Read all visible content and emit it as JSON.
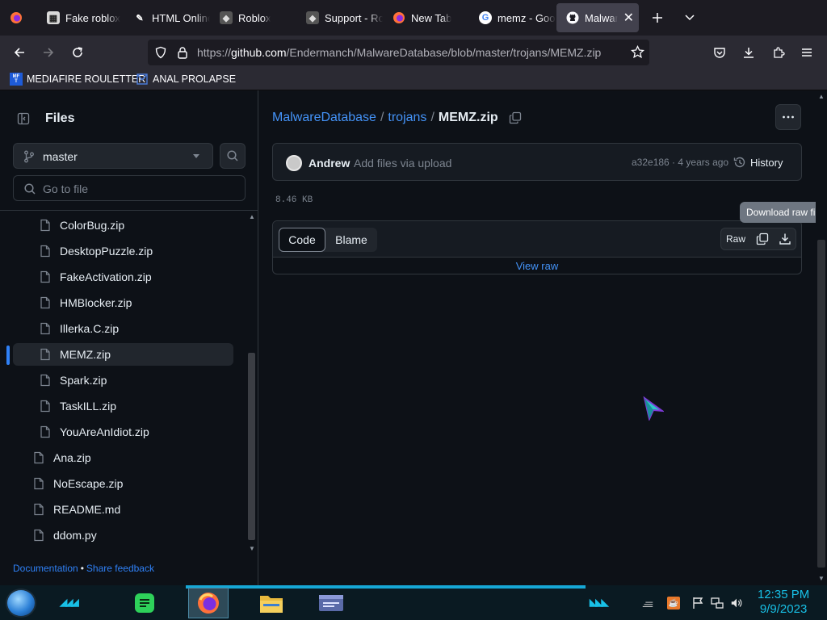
{
  "browser": {
    "tabs": [
      {
        "title": "Fake roblox",
        "icon": "roblox-logo"
      },
      {
        "title": "HTML Online",
        "icon": "pencil-icon"
      },
      {
        "title": "Roblox",
        "icon": "roblox-logo"
      },
      {
        "title": "Support - Roblox",
        "icon": "roblox-logo"
      },
      {
        "title": "New Tab",
        "icon": "firefox-logo"
      },
      {
        "title": "memz - Google",
        "icon": "google-logo"
      },
      {
        "title": "MalwareDatabase",
        "icon": "github-logo"
      }
    ],
    "url": {
      "prefix": "https://",
      "domain": "github.com",
      "path": "/Endermanch/MalwareDatabase/blob/master/trojans/MEMZ.zip"
    },
    "bookmarks": [
      {
        "label": "MEDIAFIRE ROULETTER",
        "icon_text": "MF T"
      },
      {
        "label": "ANAL PROLAPSE"
      }
    ]
  },
  "sidebar": {
    "title": "Files",
    "branch": "master",
    "goto_placeholder": "Go to file",
    "items": [
      {
        "name": "ColorBug.zip",
        "depth": 2
      },
      {
        "name": "DesktopPuzzle.zip",
        "depth": 2
      },
      {
        "name": "FakeActivation.zip",
        "depth": 2
      },
      {
        "name": "HMBlocker.zip",
        "depth": 2
      },
      {
        "name": "Illerka.C.zip",
        "depth": 2
      },
      {
        "name": "MEMZ.zip",
        "depth": 2,
        "selected": true
      },
      {
        "name": "Spark.zip",
        "depth": 2
      },
      {
        "name": "TaskILL.zip",
        "depth": 2
      },
      {
        "name": "YouAreAnIdiot.zip",
        "depth": 2
      },
      {
        "name": "Ana.zip",
        "depth": 1
      },
      {
        "name": "NoEscape.zip",
        "depth": 1
      },
      {
        "name": "README.md",
        "depth": 1
      },
      {
        "name": "ddom.py",
        "depth": 1
      }
    ],
    "footer": {
      "documentation": "Documentation",
      "separator": "•",
      "feedback": "Share feedback"
    }
  },
  "main": {
    "breadcrumb": {
      "repo": "MalwareDatabase",
      "folder": "trojans",
      "sep": "/",
      "file": "MEMZ.zip"
    },
    "commit": {
      "author": "Andrew",
      "message": "Add files via upload",
      "meta": "a32e186 · 4 years ago",
      "history": "History"
    },
    "file_size": "8.46 KB",
    "view_tabs": {
      "code": "Code",
      "blame": "Blame"
    },
    "raw_label": "Raw",
    "view_raw": "View raw",
    "tooltip": "Download raw file"
  },
  "taskbar": {
    "time": "12:35 PM",
    "date": "9/9/2023"
  },
  "colors": {
    "link": "#4493f8",
    "accent": "#2f81f7",
    "bg": "#0d1117",
    "taskbar_accent": "#18c0e6"
  }
}
